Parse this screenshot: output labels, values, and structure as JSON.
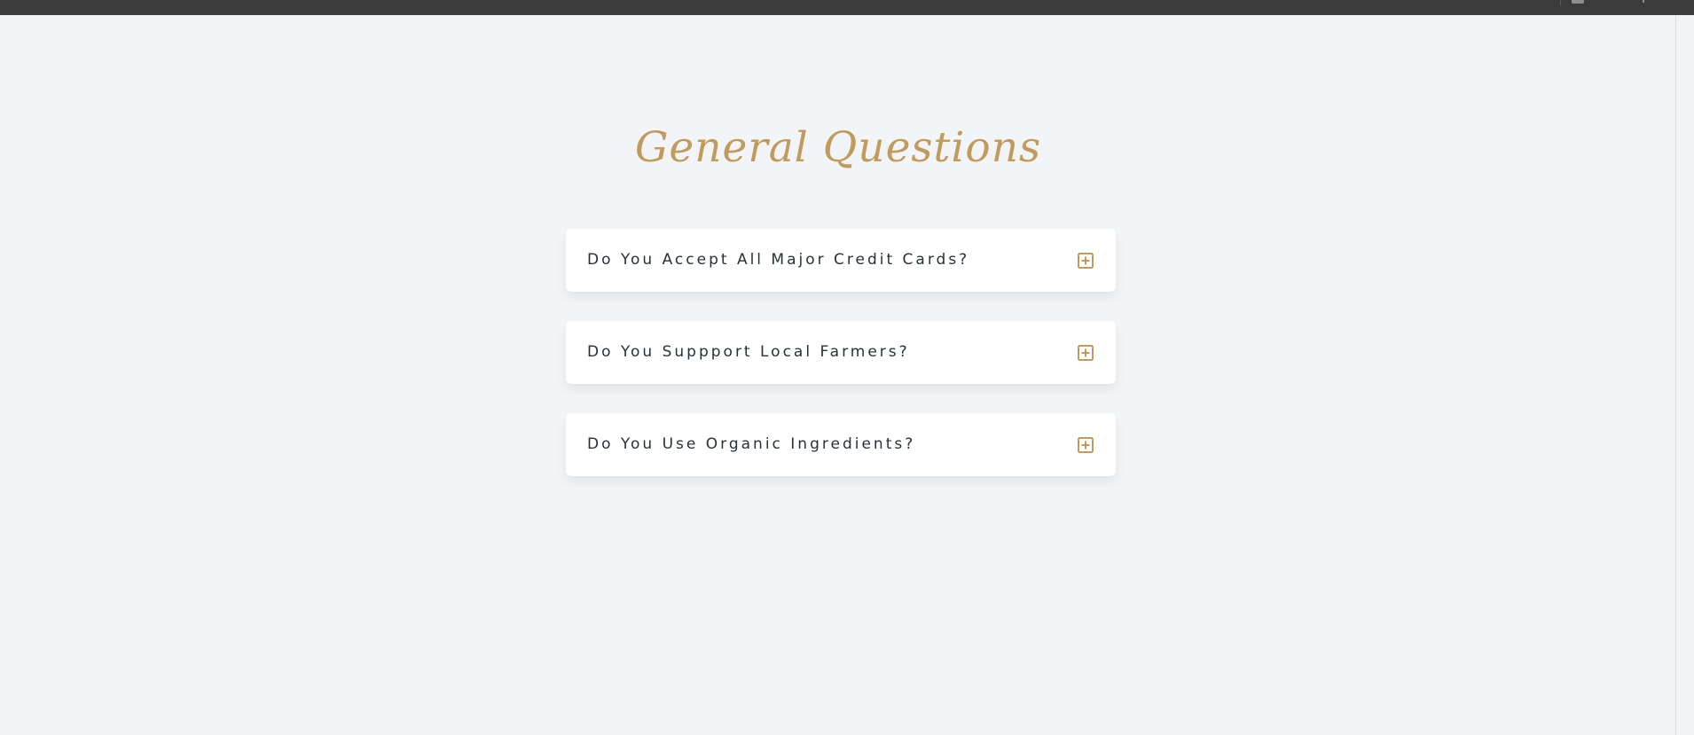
{
  "page": {
    "title": "General Questions"
  },
  "colors": {
    "accent": "#c29a5b",
    "background": "#f1f5f8",
    "topbar": "#3b3b3b",
    "card": "#ffffff",
    "text": "#26313a"
  },
  "faq": {
    "items": [
      {
        "question": "Do You Accept All Major Credit Cards?",
        "icon": "plus-square-icon",
        "expanded": false
      },
      {
        "question": "Do You Suppport Local Farmers?",
        "icon": "plus-square-icon",
        "expanded": false
      },
      {
        "question": "Do You Use Organic Ingredients?",
        "icon": "plus-square-icon",
        "expanded": false
      }
    ]
  }
}
